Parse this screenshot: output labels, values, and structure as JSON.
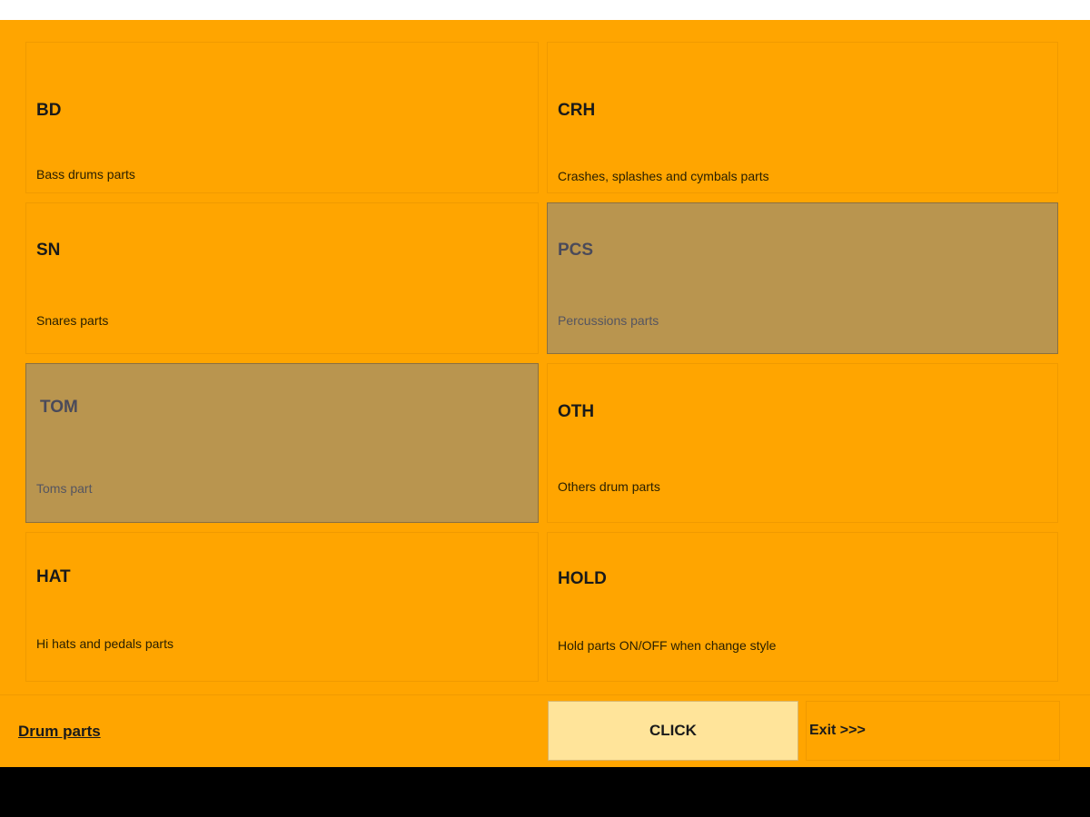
{
  "tiles": [
    {
      "code": "BD",
      "desc": "Bass drums parts"
    },
    {
      "code": "CRH",
      "desc": "Crashes, splashes and cymbals parts"
    },
    {
      "code": "SN",
      "desc": "Snares parts"
    },
    {
      "code": "PCS",
      "desc": "Percussions parts"
    },
    {
      "code": "TOM",
      "desc": "Toms part"
    },
    {
      "code": "OTH",
      "desc": "Others drum parts"
    },
    {
      "code": "HAT",
      "desc": "Hi hats and pedals parts"
    },
    {
      "code": "HOLD",
      "desc": "Hold parts ON/OFF when change style"
    }
  ],
  "footer": {
    "title": "Drum parts",
    "click_label": "CLICK",
    "exit_label": "Exit >>>"
  },
  "colors": {
    "background": "#ffa500",
    "active_tile": "#b9954f",
    "click_button": "#ffe49a"
  }
}
